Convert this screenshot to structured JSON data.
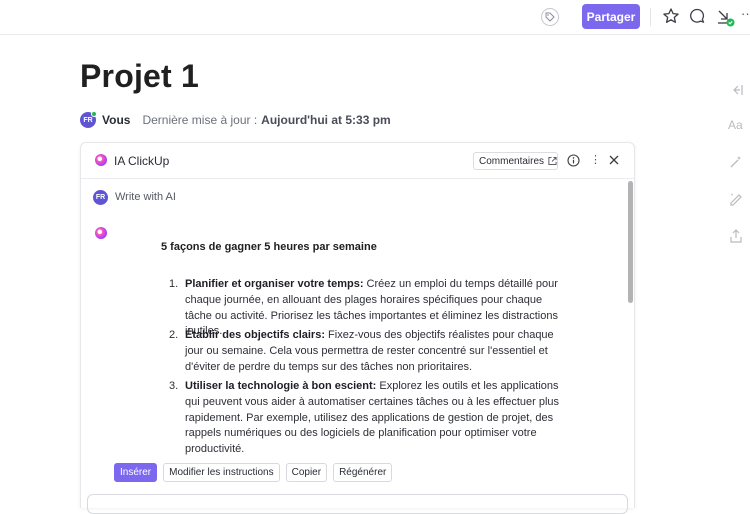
{
  "topbar": {
    "tag_icon": "tag-icon",
    "share_label": "Partager",
    "star_icon": "star-icon",
    "chat_icon": "chat-icon",
    "download_icon": "download-check-icon",
    "more_icon": "ellipsis-icon",
    "more_glyph": "···",
    "colors": {
      "accent": "#7b68ee",
      "status_ok": "#1db954"
    }
  },
  "page": {
    "title": "Projet 1",
    "avatar_initials": "FR",
    "author": "Vous",
    "updated_label": "Dernière mise à jour :",
    "updated_value": "Aujourd'hui at 5:33 pm"
  },
  "right_tools": [
    "collapse-left-icon",
    "text-format-icon",
    "magic-wand-icon",
    "ai-edit-icon",
    "export-icon"
  ],
  "right_tools_text_glyph": "Aa",
  "ai_panel": {
    "title": "IA ClickUp",
    "comments_label": "Commentaires",
    "kebab_glyph": "⋮",
    "prompt_avatar": "FR",
    "prompt_text": "Write with AI",
    "response_title": "5 façons de gagner 5 heures par semaine",
    "items": [
      {
        "num": "1.",
        "bold": "Planifier et organiser votre temps:",
        "text": " Créez un emploi du temps détaillé pour chaque journée, en allouant des plages horaires spécifiques pour chaque tâche ou activité. Priorisez les tâches importantes et éliminez les distractions inutiles."
      },
      {
        "num": "2.",
        "bold": "Établir des objectifs clairs:",
        "text": " Fixez-vous des objectifs réalistes pour chaque jour ou semaine. Cela vous permettra de rester concentré sur l'essentiel et d'éviter de perdre du temps sur des tâches non prioritaires."
      },
      {
        "num": "3.",
        "bold": "Utiliser la technologie à bon escient:",
        "text": " Explorez les outils et les applications qui peuvent vous aider à automatiser certaines tâches ou à les effectuer plus rapidement. Par exemple, utilisez des applications de gestion de projet, des rappels numériques ou des logiciels de planification pour optimiser votre productivité."
      }
    ],
    "actions": {
      "insert": "Insérer",
      "edit": "Modifier les instructions",
      "copy": "Copier",
      "regenerate": "Régénérer"
    }
  }
}
